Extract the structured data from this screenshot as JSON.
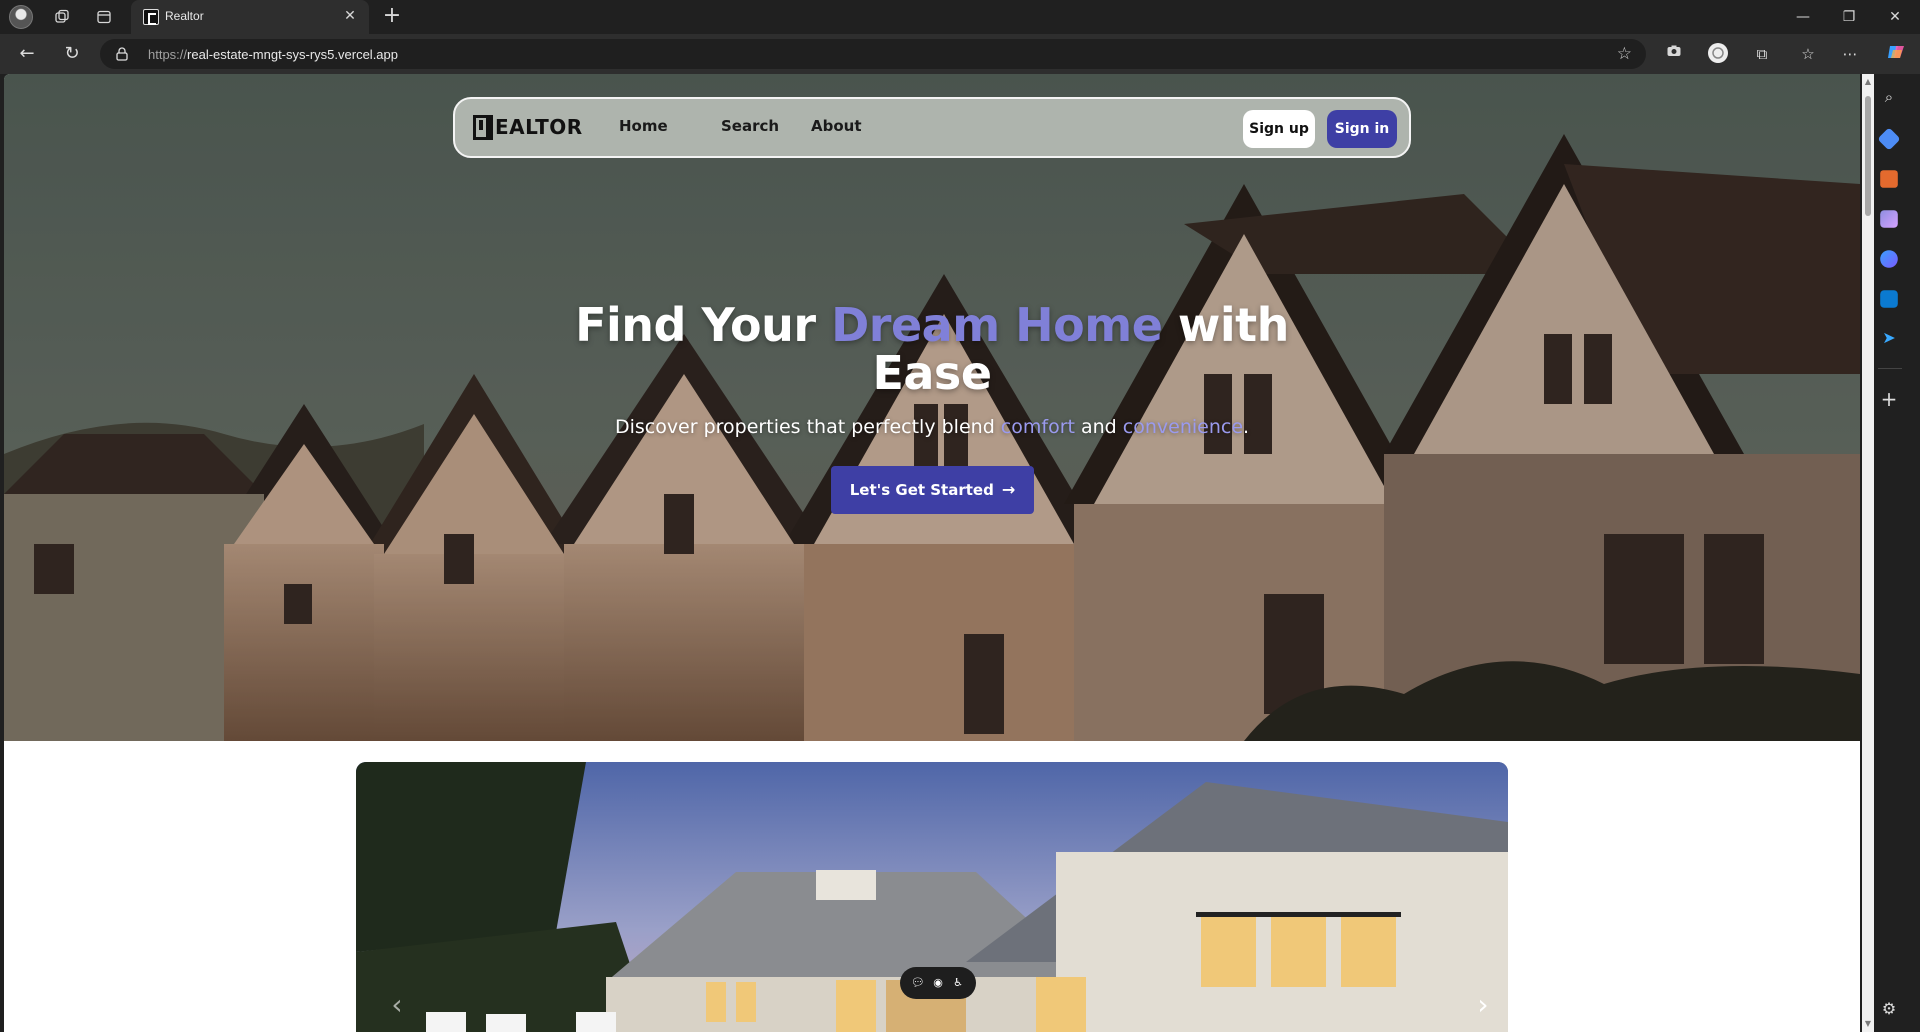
{
  "browser": {
    "tab_title": "Realtor",
    "url_protocol": "https://",
    "url_host": "real-estate-mngt-sys-rys5.vercel.app",
    "icons": [
      "profile-avatar",
      "workspaces-icon",
      "tab-actions-icon",
      "close-icon",
      "plus-icon",
      "back-icon",
      "refresh-icon",
      "lock-icon",
      "star-icon",
      "camera-icon",
      "extension-icon",
      "puzzle-icon",
      "favorites-icon",
      "more-icon",
      "copilot-icon"
    ]
  },
  "sidebar": {
    "icons": [
      "search-icon",
      "tag-icon",
      "briefcase-icon",
      "chess-icon",
      "copilot-app-icon",
      "outlook-icon",
      "send-icon",
      "add-icon",
      "settings-icon"
    ]
  },
  "site": {
    "logo_text": "EALTOR",
    "nav": {
      "home": "Home",
      "search": "Search",
      "about": "About"
    },
    "signup": "Sign up",
    "signin": "Sign in",
    "hero": {
      "title_part1": "Find Your ",
      "title_accent": "Dream Home",
      "title_part2": " with",
      "title_line2": "Ease",
      "sub_part1": "Discover properties that perfectly blend ",
      "sub_accent1": "comfort",
      "sub_part2": " and ",
      "sub_accent2": "convenience",
      "sub_part3": ".",
      "cta": "Let's Get Started"
    },
    "colors": {
      "primary": "#3e3fa5",
      "accent_text": "#8080d8"
    }
  }
}
